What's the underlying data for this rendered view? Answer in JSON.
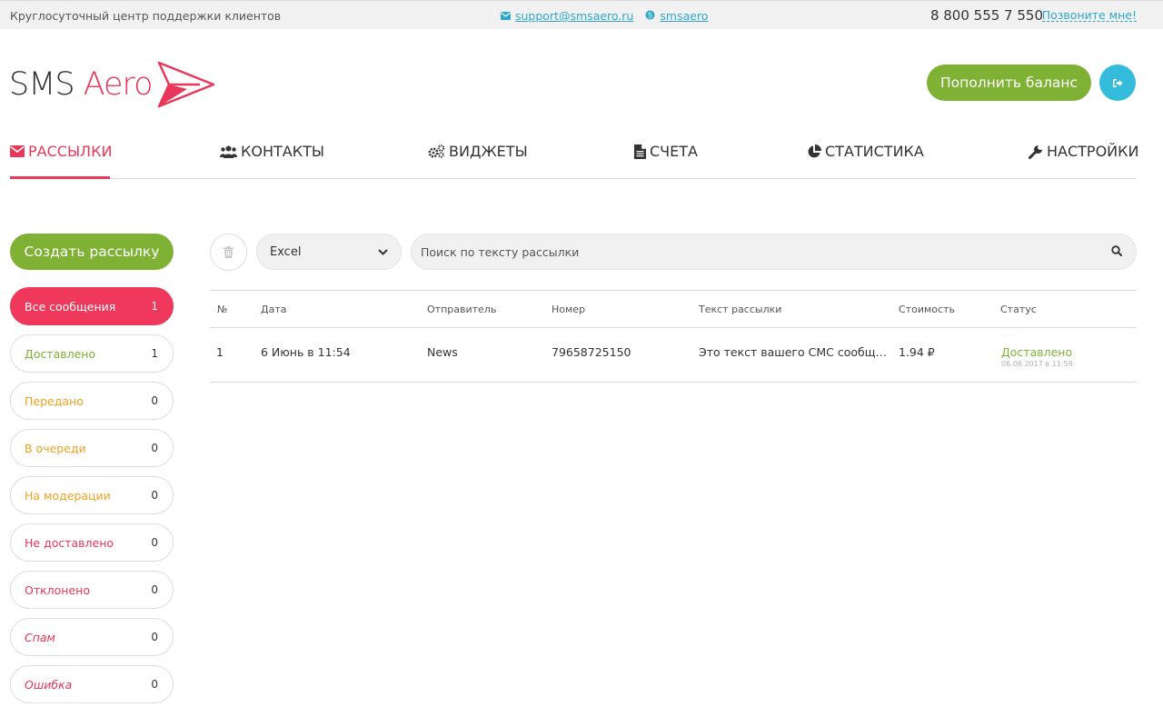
{
  "topbar": {
    "support_text": "Круглосуточный центр поддержки клиентов",
    "email": "support@smsaero.ru",
    "skype": "smsaero",
    "phone": "8 800 555 7 550",
    "callback": "Позвоните мне!"
  },
  "logo": {
    "part1": "SMS",
    "part2": "Aero",
    "accent_color": "#e83758"
  },
  "header": {
    "balance_button": "Пополнить баланс",
    "logout_icon": "sign-out-icon"
  },
  "nav": {
    "items": [
      {
        "label": "РАССЫЛКИ",
        "icon": "envelope-icon",
        "active": true
      },
      {
        "label": "КОНТАКТЫ",
        "icon": "users-icon",
        "active": false
      },
      {
        "label": "ВИДЖЕТЫ",
        "icon": "gears-icon",
        "active": false
      },
      {
        "label": "СЧЕТА",
        "icon": "file-icon",
        "active": false
      },
      {
        "label": "СТАТИСТИКА",
        "icon": "pie-chart-icon",
        "active": false
      },
      {
        "label": "НАСТРОЙКИ",
        "icon": "wrench-icon",
        "active": false
      }
    ]
  },
  "sidebar": {
    "create_button": "Создать рассылку",
    "filters": [
      {
        "label": "Все сообщения",
        "count": "1"
      },
      {
        "label": "Доставлено",
        "count": "1"
      },
      {
        "label": "Передано",
        "count": "0"
      },
      {
        "label": "В очереди",
        "count": "0"
      },
      {
        "label": "На модерации",
        "count": "0"
      },
      {
        "label": "Не доставлено",
        "count": "0"
      },
      {
        "label": "Отклонено",
        "count": "0"
      },
      {
        "label": "Спам",
        "count": "0"
      },
      {
        "label": "Ошибка",
        "count": "0"
      }
    ]
  },
  "toolbar": {
    "export_value": "Excel",
    "search_placeholder": "Поиск по тексту рассылки"
  },
  "table": {
    "headers": [
      "№",
      "Дата",
      "Отправитель",
      "Номер",
      "Текст рассылки",
      "Стоимость",
      "Статус"
    ],
    "rows": [
      {
        "num": "1",
        "date": "6 Июнь в 11:54",
        "sender": "News",
        "number": "79658725150",
        "text": "Это текст вашего СМС сообщения",
        "cost": "1.94 ₽",
        "status": "Доставлено",
        "status_time": "06.06.2017 в 11:59"
      }
    ]
  },
  "colors": {
    "brand_red": "#e83758",
    "green": "#7fb135",
    "blue": "#35bcdc",
    "orange": "#f0a21f"
  }
}
